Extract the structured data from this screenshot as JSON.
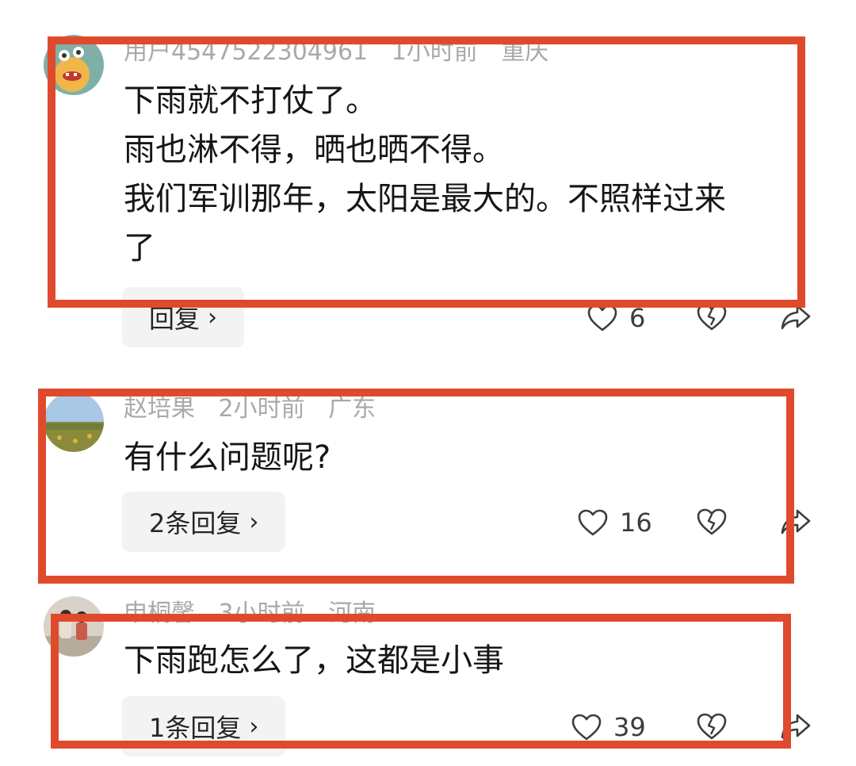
{
  "comments": [
    {
      "username": "用户4547522304961",
      "time": "1小时前",
      "location": "重庆",
      "lines": [
        "下雨就不打仗了。",
        "雨也淋不得，晒也晒不得。",
        "我们军训那年，太阳是最大的。不照样过来",
        "了"
      ],
      "reply_label": "回复",
      "likes": "6"
    },
    {
      "username": "赵培果",
      "time": "2小时前",
      "location": "广东",
      "lines": [
        "有什么问题呢?"
      ],
      "reply_label": "2条回复",
      "likes": "16"
    },
    {
      "username": "申桐馨",
      "time": "3小时前",
      "location": "河南",
      "lines": [
        "下雨跑怎么了，这都是小事"
      ],
      "reply_label": "1条回复",
      "likes": "39"
    }
  ],
  "highlight_color": "#e04a2c",
  "icons": {
    "like": "heart-outline-icon",
    "dislike": "broken-heart-icon",
    "share": "share-arrow-icon",
    "reply_chevron": "›"
  }
}
